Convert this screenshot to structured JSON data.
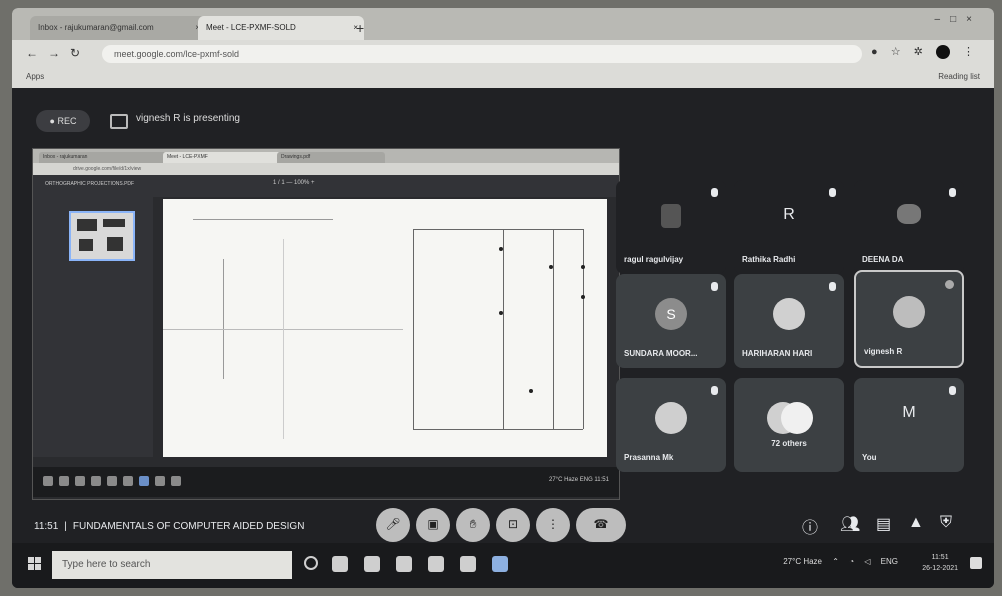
{
  "browser": {
    "tabs": [
      {
        "label": "Inbox - rajukumaran@gmail.com",
        "active": false
      },
      {
        "label": "Meet - LCE-PXMF-SOLD",
        "active": true
      }
    ],
    "new_tab": "+",
    "url": "meet.google.com/lce-pxmf-sold",
    "bookmarks": {
      "apps": "Apps",
      "reading_list": "Reading list"
    }
  },
  "meet": {
    "rec_label": "REC",
    "presenting_text": "vignesh R is presenting",
    "meeting_time": "11:51",
    "meeting_title": "FUNDAMENTALS OF COMPUTER AIDED DESIGN"
  },
  "shared_screen": {
    "tabs": [
      {
        "label": "Inbox - rajukumaran"
      },
      {
        "label": "Meet - LCE-PXMF"
      },
      {
        "label": "Drawings.pdf"
      }
    ],
    "url": "drive.google.com/file/d/1x/view",
    "filename": "ORTHOGRAPHIC PROJECTIONS.PDF",
    "pager": "1 / 1   —   100%   +",
    "tray": "27°C  Haze  ENG  11:51"
  },
  "participants": [
    {
      "name": "ragul ragulvijay",
      "initial": "",
      "style": "photo"
    },
    {
      "name": "Rathika Radhi",
      "initial": "R",
      "style": "letter"
    },
    {
      "name": "DEENA DA",
      "initial": "",
      "style": "photo"
    },
    {
      "name": "SUNDARA MOOR...",
      "initial": "S",
      "style": "avatar"
    },
    {
      "name": "HARIHARAN HARI",
      "initial": "",
      "style": "photo"
    },
    {
      "name": "vignesh R",
      "initial": "",
      "style": "photo"
    },
    {
      "name": "Prasanna Mk",
      "initial": "",
      "style": "avatar"
    },
    {
      "name": "72 others",
      "initial": "",
      "style": "group"
    },
    {
      "name": "You",
      "initial": "M",
      "style": "letter"
    }
  ],
  "taskbar": {
    "search_placeholder": "Type here to search",
    "weather": "27°C Haze",
    "lang": "ENG",
    "time": "11:51",
    "date": "26-12-2021"
  }
}
